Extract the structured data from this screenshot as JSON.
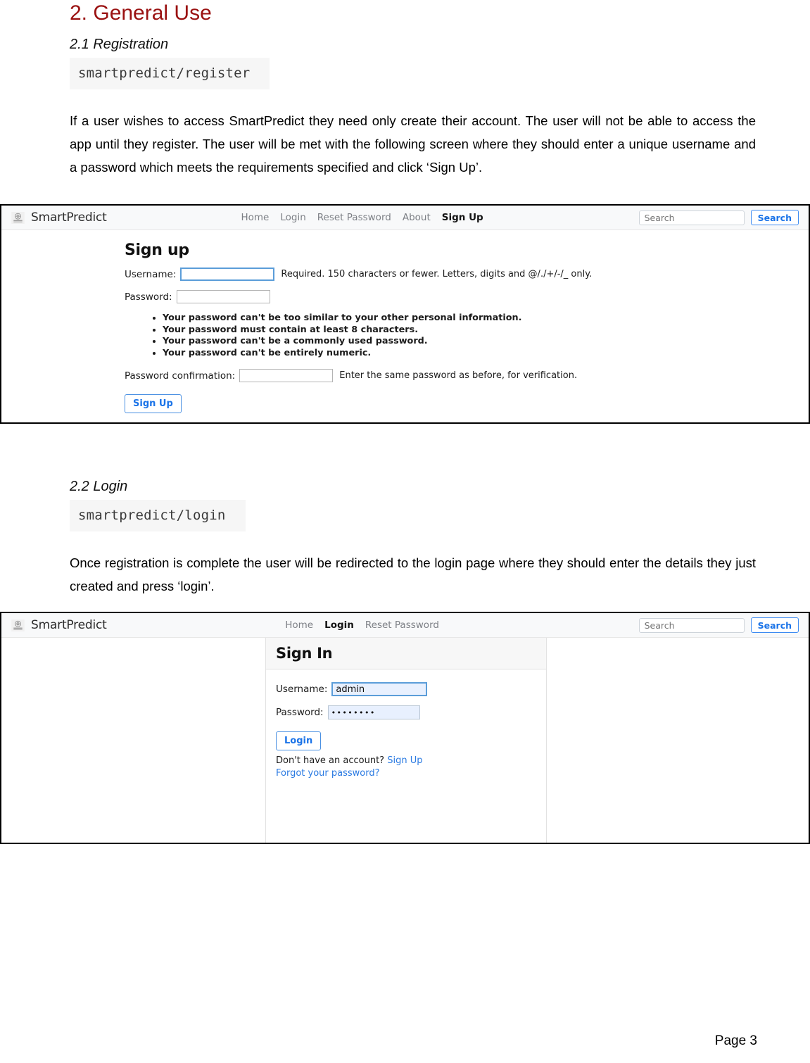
{
  "document": {
    "heading": "2. General Use",
    "sections": [
      {
        "heading": "2.1 Registration",
        "code": "smartpredict/register",
        "paragraph": "If a user wishes to access SmartPredict they need only create their account. The user will not be able to access the app until they register. The user will be met with the following screen where they should enter a unique username and a password which meets the requirements specified and click ‘Sign Up’."
      },
      {
        "heading": "2.2 Login",
        "code": "smartpredict/login",
        "paragraph": "Once registration is complete the user will be redirected to the login page where they should enter the details they just created and press ‘login’."
      }
    ],
    "footer": "Page 3"
  },
  "signup_screenshot": {
    "navbar": {
      "brand": "SmartPredict",
      "brand_logo_icon": "emblem-badge-icon",
      "links": [
        {
          "label": "Home",
          "active": false
        },
        {
          "label": "Login",
          "active": false
        },
        {
          "label": "Reset Password",
          "active": false
        },
        {
          "label": "About",
          "active": false
        },
        {
          "label": "Sign Up",
          "active": true
        }
      ],
      "search_placeholder": "Search",
      "search_value": "",
      "search_button": "Search"
    },
    "title": "Sign up",
    "username_label": "Username:",
    "username_value": "",
    "username_help": "Required. 150 characters or fewer. Letters, digits and @/./+/-/_ only.",
    "password_label": "Password:",
    "password_value": "",
    "password_rules": [
      "Your password can't be too similar to your other personal information.",
      "Your password must contain at least 8 characters.",
      "Your password can't be a commonly used password.",
      "Your password can't be entirely numeric."
    ],
    "confirm_label": "Password confirmation:",
    "confirm_value": "",
    "confirm_help": "Enter the same password as before, for verification.",
    "submit_button": "Sign Up"
  },
  "login_screenshot": {
    "navbar": {
      "brand": "SmartPredict",
      "brand_logo_icon": "emblem-badge-icon",
      "links": [
        {
          "label": "Home",
          "active": false
        },
        {
          "label": "Login",
          "active": true
        },
        {
          "label": "Reset Password",
          "active": false
        }
      ],
      "search_placeholder": "Search",
      "search_value": "",
      "search_button": "Search"
    },
    "card_title": "Sign In",
    "username_label": "Username:",
    "username_value": "admin",
    "password_label": "Password:",
    "password_value": "••••••••",
    "submit_button": "Login",
    "signup_prompt": "Don't have an account?",
    "signup_link": "Sign Up",
    "forgot_link": "Forgot your password?"
  },
  "colors": {
    "heading_red": "#9a1111",
    "link_blue": "#2a7ae2",
    "button_blue": "#1a73e8",
    "navbar_bg": "#f8f9fa",
    "code_bg": "#f6f6f6",
    "focus_border": "#5b9dd9"
  }
}
